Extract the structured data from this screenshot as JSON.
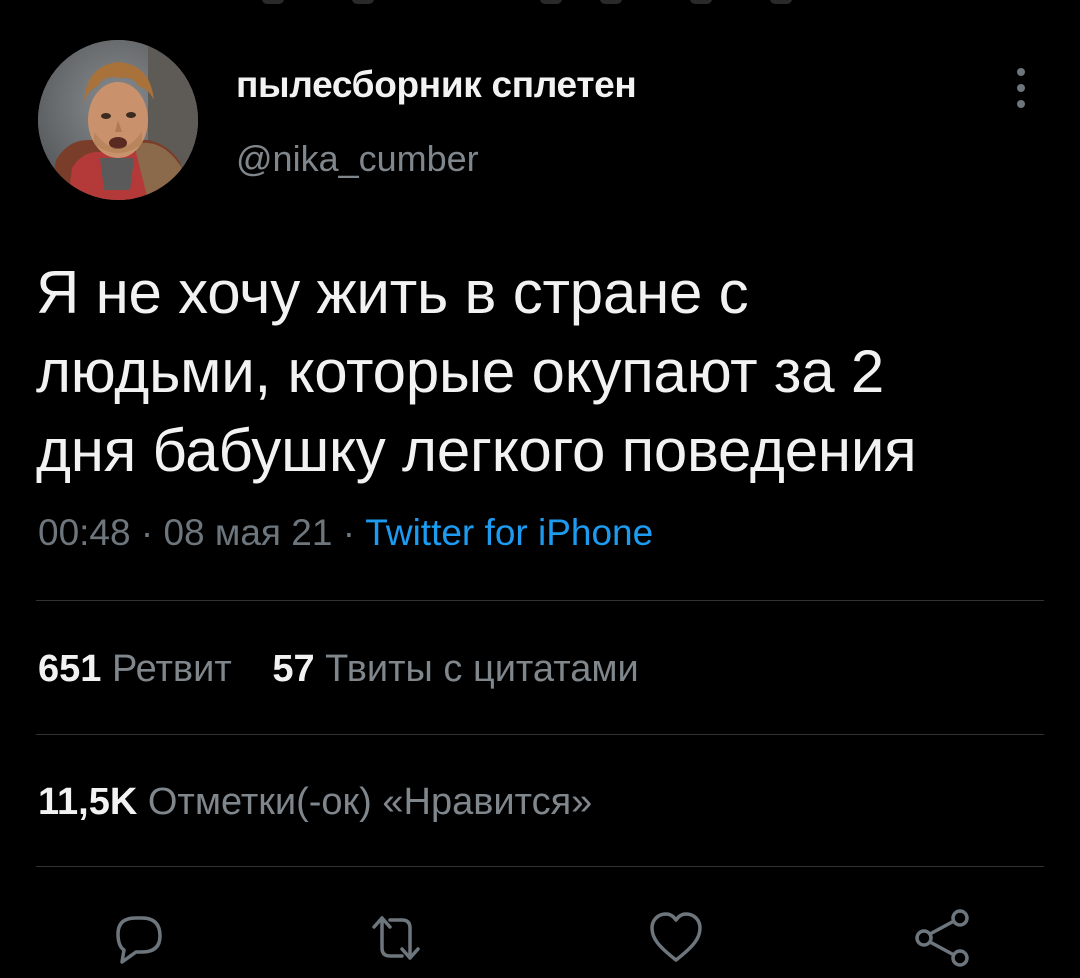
{
  "colors": {
    "background": "#000000",
    "text_primary": "#f2f2f2",
    "text_secondary": "#7f868c",
    "link": "#1d9bf0",
    "divider": "#2f3336"
  },
  "tweet": {
    "author_name": "пылесборник сплетен",
    "author_handle": "@nika_cumber",
    "text_lines": [
      "Я не хочу жить в стране с",
      "людьми, которые окупают за 2",
      "дня бабушку легкого поведения"
    ],
    "time": "00:48",
    "separator": "·",
    "date": "08 мая 21",
    "source": "Twitter for iPhone"
  },
  "stats": {
    "retweets_count": "651",
    "retweets_label": "Ретвит",
    "quotes_count": "57",
    "quotes_label": "Твиты с цитатами",
    "likes_count": "11,5K",
    "likes_label": "Отметки(-ок) «Нравится»"
  },
  "icons": {
    "more": "more-vertical-icon",
    "reply": "reply-icon",
    "retweet": "retweet-icon",
    "like": "heart-icon",
    "share": "share-icon"
  }
}
